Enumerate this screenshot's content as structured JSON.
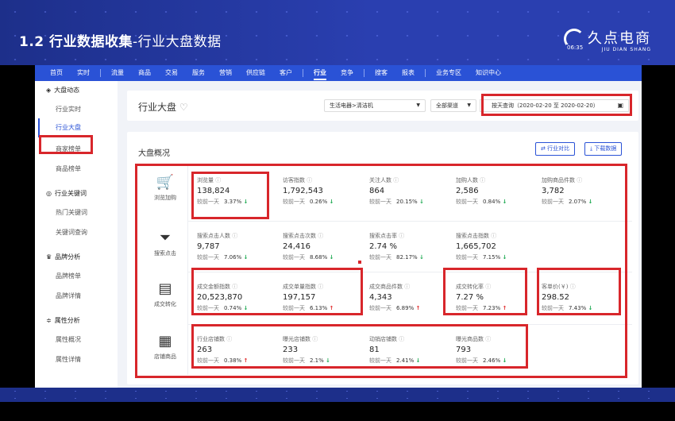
{
  "slide": {
    "title_bold": "1.2  行业数据收集",
    "title_thin": "-行业大盘数据"
  },
  "logo": {
    "cn": "久点电商",
    "en": "JIU DIAN SHANG",
    "time": "06:35"
  },
  "nav": [
    "首页",
    "实时",
    "流量",
    "商品",
    "交易",
    "服务",
    "营销",
    "供应链",
    "客户",
    "行业",
    "竞争",
    "搜客",
    "报表",
    "业务专区",
    "知识中心"
  ],
  "nav_active": "行业",
  "sidebar": {
    "groups": [
      {
        "icon": "◈",
        "label": "大盘动态",
        "items": [
          "行业实时",
          "行业大盘",
          "商家榜单",
          "商品榜单"
        ]
      },
      {
        "icon": "◎",
        "label": "行业关键词",
        "items": [
          "热门关键词",
          "关键词查询"
        ]
      },
      {
        "icon": "♛",
        "label": "品牌分析",
        "items": [
          "品牌榜单",
          "品牌详情"
        ]
      },
      {
        "icon": "≑",
        "label": "属性分析",
        "items": [
          "属性概况",
          "属性详情"
        ]
      }
    ],
    "active": "行业大盘"
  },
  "header": {
    "title": "行业大盘",
    "category": "生活电器>清洁机",
    "channel": "全部渠道",
    "date": "按天查询（2020-02-20 至 2020-02-20）"
  },
  "overview": {
    "title": "大盘概况",
    "compare_btn": "⇄ 行业对比",
    "download_btn": "⤓ 下载数据",
    "compare_text": "较前一天",
    "rows": [
      {
        "label": "浏览加购",
        "icon": "cart-icon",
        "glyph": "🛒",
        "metrics": [
          {
            "name": "浏览量",
            "value": "138,824",
            "pct": "3.37%",
            "dir": "down"
          },
          {
            "name": "访客指数",
            "value": "1,792,543",
            "pct": "0.26%",
            "dir": "down"
          },
          {
            "name": "关注人数",
            "value": "864",
            "pct": "20.15%",
            "dir": "down"
          },
          {
            "name": "加购人数",
            "value": "2,586",
            "pct": "0.84%",
            "dir": "down"
          },
          {
            "name": "加购商品件数",
            "value": "3,782",
            "pct": "2.07%",
            "dir": "down"
          }
        ]
      },
      {
        "label": "搜索点击",
        "icon": "filter-icon",
        "glyph": "⏷",
        "metrics": [
          {
            "name": "搜索点击人数",
            "value": "9,787",
            "pct": "7.06%",
            "dir": "down"
          },
          {
            "name": "搜索点击次数",
            "value": "24,416",
            "pct": "8.68%",
            "dir": "down"
          },
          {
            "name": "搜索点击率",
            "value": "2.74 %",
            "pct": "82.17%",
            "dir": "down"
          },
          {
            "name": "搜索点击指数",
            "value": "1,665,702",
            "pct": "7.15%",
            "dir": "down"
          }
        ]
      },
      {
        "label": "成交转化",
        "icon": "document-icon",
        "glyph": "▤",
        "metrics": [
          {
            "name": "成交金额指数",
            "value": "20,523,870",
            "pct": "0.74%",
            "dir": "down"
          },
          {
            "name": "成交单量指数",
            "value": "197,157",
            "pct": "6.13%",
            "dir": "up"
          },
          {
            "name": "成交商品件数",
            "value": "4,343",
            "pct": "6.89%",
            "dir": "up"
          },
          {
            "name": "成交转化率",
            "value": "7.27 %",
            "pct": "7.23%",
            "dir": "up"
          },
          {
            "name": "客单价(￥)",
            "value": "298.52",
            "pct": "7.43%",
            "dir": "down"
          }
        ]
      },
      {
        "label": "店铺商品",
        "icon": "grid-icon",
        "glyph": "▦",
        "metrics": [
          {
            "name": "行业店铺数",
            "value": "263",
            "pct": "0.38%",
            "dir": "up"
          },
          {
            "name": "曝光店铺数",
            "value": "233",
            "pct": "2.1%",
            "dir": "down"
          },
          {
            "name": "动销店铺数",
            "value": "81",
            "pct": "2.41%",
            "dir": "down"
          },
          {
            "name": "曝光商品数",
            "value": "793",
            "pct": "2.46%",
            "dir": "down"
          }
        ]
      }
    ]
  },
  "colors": {
    "accent": "#2a52d6",
    "highlight": "#d8262b",
    "down": "#1aa84f",
    "up": "#e03030"
  }
}
